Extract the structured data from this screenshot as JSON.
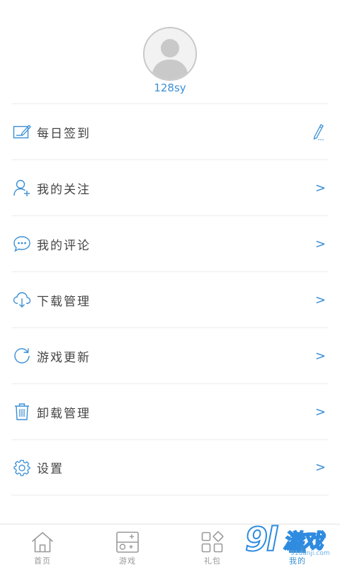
{
  "profile": {
    "username": "128sy"
  },
  "menu": {
    "items": [
      {
        "label": "每日签到",
        "icon": "checkin-icon",
        "right": "edit-icon"
      },
      {
        "label": "我的关注",
        "icon": "add-user-icon",
        "right": ">"
      },
      {
        "label": "我的评论",
        "icon": "comment-icon",
        "right": ">"
      },
      {
        "label": "下载管理",
        "icon": "cloud-download-icon",
        "right": ">"
      },
      {
        "label": "游戏更新",
        "icon": "refresh-icon",
        "right": ">"
      },
      {
        "label": "卸载管理",
        "icon": "trash-icon",
        "right": ">"
      },
      {
        "label": "设置",
        "icon": "gear-icon",
        "right": ">"
      }
    ]
  },
  "tabbar": {
    "tabs": [
      {
        "label": "首页",
        "icon": "home-icon"
      },
      {
        "label": "游戏",
        "icon": "gamepad-icon"
      },
      {
        "label": "礼包",
        "icon": "gift-grid-icon"
      },
      {
        "label": "我的",
        "icon": "user-icon",
        "active": true
      }
    ]
  },
  "watermark": {
    "number": "9l",
    "text": "游戏",
    "url": "91danji.com"
  },
  "colors": {
    "accent": "#3a8fd6",
    "divider": "#ececec",
    "text": "#444444",
    "tab_inactive": "#999999"
  }
}
